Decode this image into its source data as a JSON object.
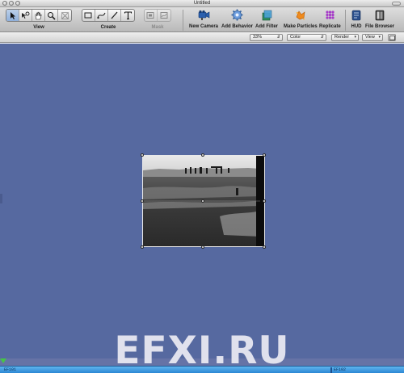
{
  "window": {
    "title": "Untitled"
  },
  "toolbar": {
    "groups": [
      {
        "label": "View",
        "tools": [
          {
            "icon": "select-arrow-icon",
            "active": true
          },
          {
            "icon": "adjust-3d-transform-icon",
            "active": false
          },
          {
            "icon": "pan-hand-icon",
            "active": false
          },
          {
            "icon": "zoom-magnifier-icon",
            "active": false
          },
          {
            "icon": "transform-disabled-icon",
            "active": false
          }
        ]
      },
      {
        "label": "Create",
        "tools": [
          {
            "icon": "rectangle-icon"
          },
          {
            "icon": "bezier-icon"
          },
          {
            "icon": "paint-stroke-icon"
          },
          {
            "icon": "text-icon"
          }
        ]
      },
      {
        "label": "Mask",
        "disabled": true,
        "tools": [
          {
            "icon": "rectangle-mask-icon"
          },
          {
            "icon": "bezier-mask-icon"
          }
        ]
      }
    ],
    "buttons": [
      {
        "name": "new-camera",
        "label": "New Camera",
        "icon": "camera-icon",
        "color": "#2a5fae"
      },
      {
        "name": "add-behavior",
        "label": "Add Behavior",
        "icon": "gear-behavior-icon",
        "color": "#5a8fd0"
      },
      {
        "name": "add-filter",
        "label": "Add Filter",
        "icon": "filter-icon",
        "color": "#2f8f5a"
      },
      {
        "name": "make-particles",
        "label": "Make Particles",
        "icon": "particles-icon",
        "color": "#f08a1c"
      },
      {
        "name": "replicate",
        "label": "Replicate",
        "icon": "replicate-icon",
        "color": "#a63cc8"
      },
      {
        "name": "hud",
        "label": "HUD",
        "icon": "hud-icon",
        "color": "#2b4f8c"
      },
      {
        "name": "file-browser",
        "label": "File Browser",
        "icon": "file-browser-icon",
        "color": "#3a3a3a"
      }
    ]
  },
  "optionsbar": {
    "zoom": "33%",
    "channels": "Color",
    "render": "Render",
    "view": "View"
  },
  "timeline": {
    "start_frame": "EF101",
    "end_frame": "EF102"
  },
  "watermark": "EFXI.RU",
  "colors": {
    "canvas": "#5669a0",
    "timeline_bar": "#2c88d4",
    "playhead": "#46c446"
  }
}
